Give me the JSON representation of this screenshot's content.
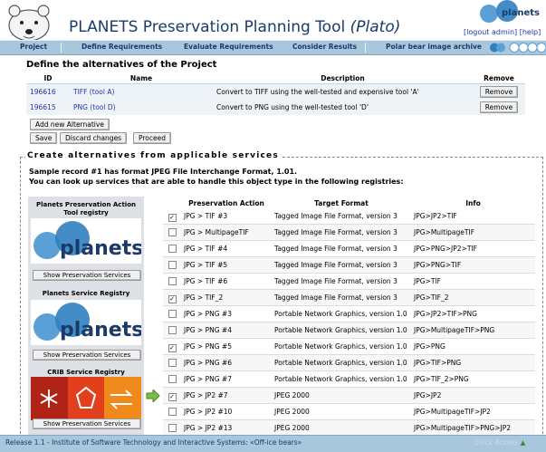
{
  "header": {
    "title_main": "PLANETS Preservation Planning Tool ",
    "title_italic": "(Plato)",
    "logo_text": "planets",
    "logout_label": "[logout admin]",
    "help_label": "[help]"
  },
  "nav": {
    "items": [
      "Project",
      "Define Requirements",
      "Evaluate Requirements",
      "Consider Results",
      "Polar bear image archive"
    ]
  },
  "alternatives": {
    "heading": "Define the alternatives of the Project",
    "columns": [
      "ID",
      "Name",
      "Description",
      "Remove"
    ],
    "rows": [
      {
        "id": "196616",
        "name": "TIFF (tool A)",
        "description": "Convert to TIFF using the well-tested and expensive tool 'A'",
        "remove": "Remove"
      },
      {
        "id": "196615",
        "name": "PNG (tool D)",
        "description": "Convert to PNG using the well-tested tool 'D'",
        "remove": "Remove"
      }
    ],
    "add_label": "Add new Alternative",
    "save_label": "Save",
    "discard_label": "Discard changes",
    "proceed_label": "Proceed"
  },
  "services": {
    "legend": "Create alternatives from applicable services",
    "sample_line1": "Sample record #1 has format JPEG File Interchange Format, 1.01.",
    "sample_line2": "You can look up services that are able to handle this object type in the following registries:",
    "registries": [
      {
        "title": "Planets Preservation Action Tool registry",
        "button": "Show Preservation Services"
      },
      {
        "title": "Planets Service Registry",
        "button": "Show Preservation Services"
      },
      {
        "title": "CRIB Service Registry",
        "button": "Show Preservation Services"
      }
    ],
    "columns": [
      "",
      "Preservation Action",
      "Target Format",
      "Info"
    ],
    "rows": [
      {
        "checked": true,
        "action": "JPG > TIF #3",
        "format": "Tagged Image File Format, version 3",
        "info": "JPG>JP2>TIF"
      },
      {
        "checked": false,
        "action": "JPG > MultipageTIF",
        "format": "Tagged Image File Format, version 3",
        "info": "JPG>MultipageTIF"
      },
      {
        "checked": false,
        "action": "JPG > TIF #4",
        "format": "Tagged Image File Format, version 3",
        "info": "JPG>PNG>JP2>TIF"
      },
      {
        "checked": false,
        "action": "JPG > TIF #5",
        "format": "Tagged Image File Format, version 3",
        "info": "JPG>PNG>TIF"
      },
      {
        "checked": false,
        "action": "JPG > TIF #6",
        "format": "Tagged Image File Format, version 3",
        "info": "JPG>TIF"
      },
      {
        "checked": true,
        "action": "JPG > TIF_2",
        "format": "Tagged Image File Format, version 3",
        "info": "JPG>TIF_2"
      },
      {
        "checked": false,
        "action": "JPG > PNG #3",
        "format": "Portable Network Graphics, version 1.0",
        "info": "JPG>JP2>TIF>PNG"
      },
      {
        "checked": false,
        "action": "JPG > PNG #4",
        "format": "Portable Network Graphics, version 1.0",
        "info": "JPG>MultipageTIF>PNG"
      },
      {
        "checked": true,
        "action": "JPG > PNG #5",
        "format": "Portable Network Graphics, version 1.0",
        "info": "JPG>PNG"
      },
      {
        "checked": false,
        "action": "JPG > PNG #6",
        "format": "Portable Network Graphics, version 1.0",
        "info": "JPG>TIF>PNG"
      },
      {
        "checked": false,
        "action": "JPG > PNG #7",
        "format": "Portable Network Graphics, version 1.0",
        "info": "JPG>TIF_2>PNG"
      },
      {
        "checked": true,
        "action": "JPG > JP2 #7",
        "format": "JPEG 2000",
        "info": "JPG>JP2"
      },
      {
        "checked": false,
        "action": "JPG > JP2 #10",
        "format": "JPEG 2000",
        "info": "JPG>MultipageTIF>JP2"
      },
      {
        "checked": false,
        "action": "JPG > JP2 #13",
        "format": "JPEG 2000",
        "info": "JPG>MultipageTIF>PNG>JP2"
      }
    ]
  },
  "footer": {
    "text": "Release 1.1 - Institute of Software Technology and Interactive Systems: «Off-ice bears»",
    "quick_access": "Quick Access"
  },
  "colors": {
    "nav_bg": "#a9c7dc",
    "title": "#1a3a6a",
    "link": "#2233aa"
  }
}
